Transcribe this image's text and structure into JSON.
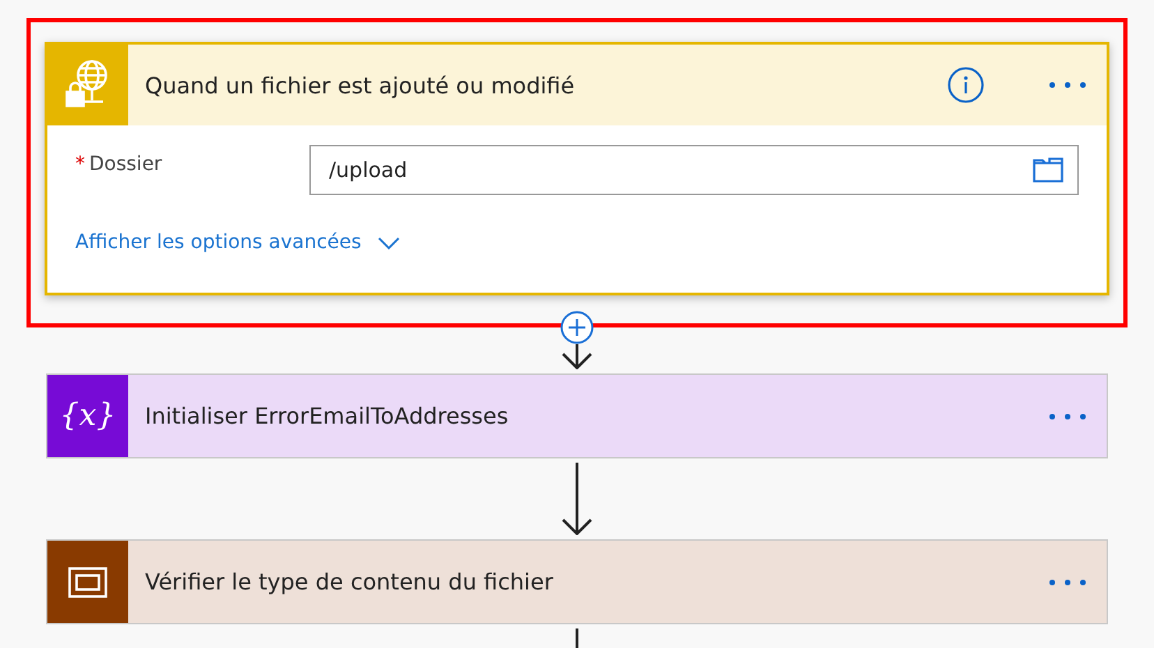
{
  "steps": [
    {
      "kind": "trigger",
      "title": "Quand un fichier est ajouté ou modifié",
      "color": "#e5b600",
      "highlighted": true,
      "info": true,
      "fields": [
        {
          "label": "Dossier",
          "required": true,
          "required_mark": "*",
          "value": "/upload"
        }
      ],
      "advanced_link": "Afficher les options avancées"
    },
    {
      "kind": "variable",
      "title": "Initialiser ErrorEmailToAddresses",
      "color": "#770bd6",
      "icon_text": "{x}",
      "highlighted": false,
      "info": false
    },
    {
      "kind": "condition",
      "title": "Vérifier le type de contenu du fichier",
      "color": "#893a00",
      "highlighted": false,
      "info": false
    }
  ]
}
